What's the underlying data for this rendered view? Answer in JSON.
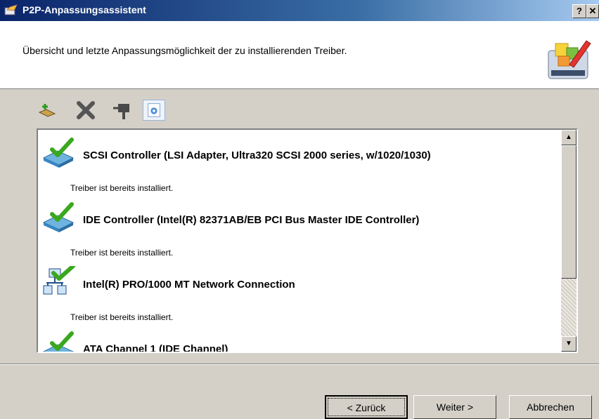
{
  "window": {
    "title": "P2P-Anpassungsassistent",
    "help_label": "?",
    "close_label": "✕"
  },
  "header": {
    "text": "Übersicht und letzte Anpassungsmöglichkeit der zu installierenden Treiber."
  },
  "toolbar": {
    "icons": [
      "add-driver-icon",
      "delete-icon",
      "pin-icon",
      "settings-icon"
    ]
  },
  "drivers": [
    {
      "title": "SCSI Controller (LSI Adapter, Ultra320 SCSI 2000 series, w/1020/1030)",
      "status": "Treiber ist bereits installiert.",
      "icon": "storage-controller-icon"
    },
    {
      "title": "IDE Controller (Intel(R) 82371AB/EB PCI Bus Master IDE Controller)",
      "status": "Treiber ist bereits installiert.",
      "icon": "storage-controller-icon"
    },
    {
      "title": "Intel(R) PRO/1000 MT Network Connection",
      "status": "Treiber ist bereits installiert.",
      "icon": "network-icon"
    },
    {
      "title": "ATA Channel 1 (IDE Channel)",
      "status": "",
      "icon": "storage-controller-icon"
    }
  ],
  "buttons": {
    "back": "< Zurück",
    "next": "Weiter >",
    "cancel": "Abbrechen"
  },
  "colors": {
    "accent": "#0a246a",
    "check": "#3aa81e"
  }
}
